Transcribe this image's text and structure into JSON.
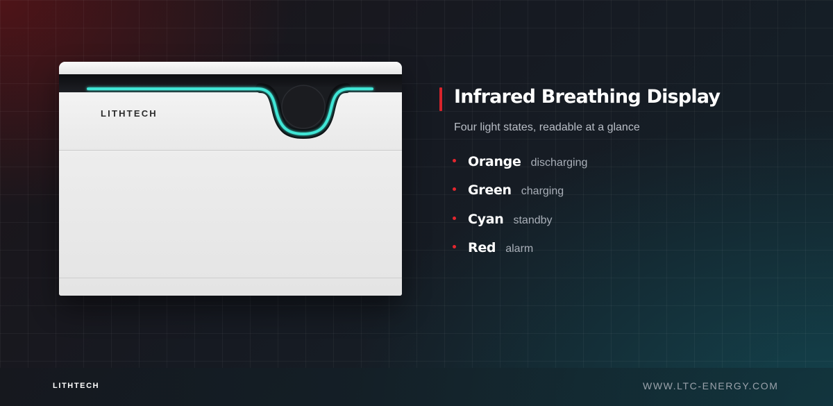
{
  "product": {
    "brand": "LITHTECH",
    "led_color": "#3fe6d6"
  },
  "panel": {
    "title": "Infrared Breathing Display",
    "subtitle": "Four light states, readable at a glance",
    "accent_color": "#d8242c",
    "states": [
      {
        "name": "Orange",
        "desc": "discharging"
      },
      {
        "name": "Green",
        "desc": "charging"
      },
      {
        "name": "Cyan",
        "desc": "standby"
      },
      {
        "name": "Red",
        "desc": "alarm"
      }
    ]
  },
  "footer": {
    "brand": "LITHTECH",
    "url": "WWW.LTC-ENERGY.COM"
  }
}
